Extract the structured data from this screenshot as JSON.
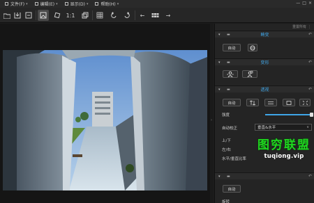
{
  "menubar": {
    "items": [
      {
        "label": "文件(F)"
      },
      {
        "label": "编辑(E)"
      },
      {
        "label": "显示(D)"
      },
      {
        "label": "帮助(H)"
      }
    ],
    "window_controls": [
      "—",
      "□",
      "×"
    ]
  },
  "toolbar": {
    "zoom_label": "1:1",
    "buttons": [
      "open-folder-icon",
      "save-icon",
      "export-icon",
      "image-icon",
      "rotate-tool-icon",
      "zoom-1-1",
      "compare-icon",
      "grid-icon",
      "rotate-left-icon",
      "rotate-right-icon",
      "prev-arrow-icon",
      "filmstrip-icon",
      "next-arrow-icon"
    ]
  },
  "panel": {
    "top_label": "重置所有",
    "sections": {
      "section1": {
        "title": "畸变",
        "auto_button": "自动"
      },
      "section2": {
        "title": "变形"
      },
      "section3": {
        "title": "透视",
        "auto_button": "自动",
        "strength_label": "强度",
        "auto_correct_label": "自动校正",
        "auto_correct_value": "垂直&水平",
        "updown_label": "上/下",
        "leftright_label": "左/右",
        "ratio_label": "水平/垂直比率"
      },
      "section4": {
        "auto_button": "自动",
        "partial_label": "旋转"
      }
    }
  },
  "watermark": {
    "logo": "图穷联盟",
    "url": "tuqiong.vip"
  }
}
